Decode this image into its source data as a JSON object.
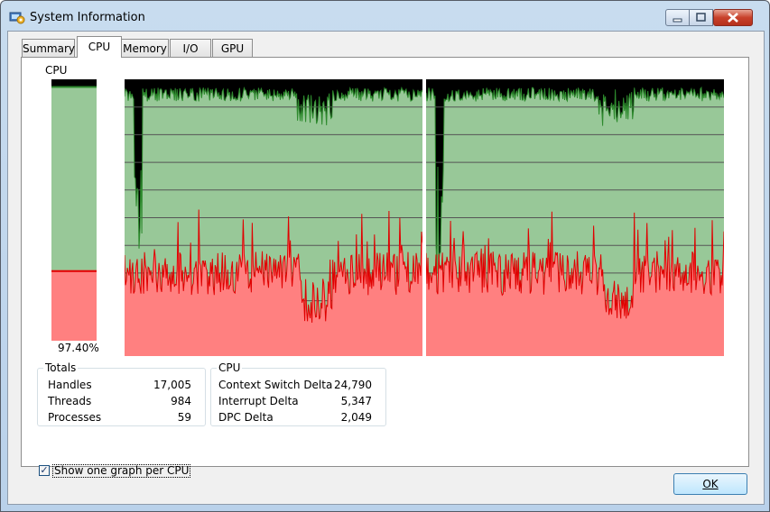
{
  "window": {
    "title": "System Information"
  },
  "tabs": [
    {
      "label": "Summary",
      "active": false
    },
    {
      "label": "CPU",
      "active": true
    },
    {
      "label": "Memory",
      "active": false
    },
    {
      "label": "I/O",
      "active": false
    },
    {
      "label": "GPU",
      "active": false
    }
  ],
  "cpu": {
    "meter_label": "CPU",
    "usage_text": "97.40%",
    "usage_percent": 97.4,
    "kernel_percent": 27,
    "colors": {
      "total": "#98c898",
      "total_line": "#2d8a2d",
      "kernel": "#ff8080",
      "kernel_line": "#e00000"
    }
  },
  "totals": {
    "title": "Totals",
    "rows": [
      {
        "label": "Handles",
        "value": "17,005"
      },
      {
        "label": "Threads",
        "value": "984"
      },
      {
        "label": "Processes",
        "value": "59"
      }
    ]
  },
  "cpu_stats": {
    "title": "CPU",
    "rows": [
      {
        "label": "Context Switch Delta",
        "value": "24,790"
      },
      {
        "label": "Interrupt Delta",
        "value": "5,347"
      },
      {
        "label": "DPC Delta",
        "value": "2,049"
      }
    ]
  },
  "options": {
    "one_graph_per_cpu_label": "Show one graph per CPU",
    "one_graph_per_cpu_checked": true,
    "check_glyph": "✓"
  },
  "buttons": {
    "ok_label": "OK"
  }
}
